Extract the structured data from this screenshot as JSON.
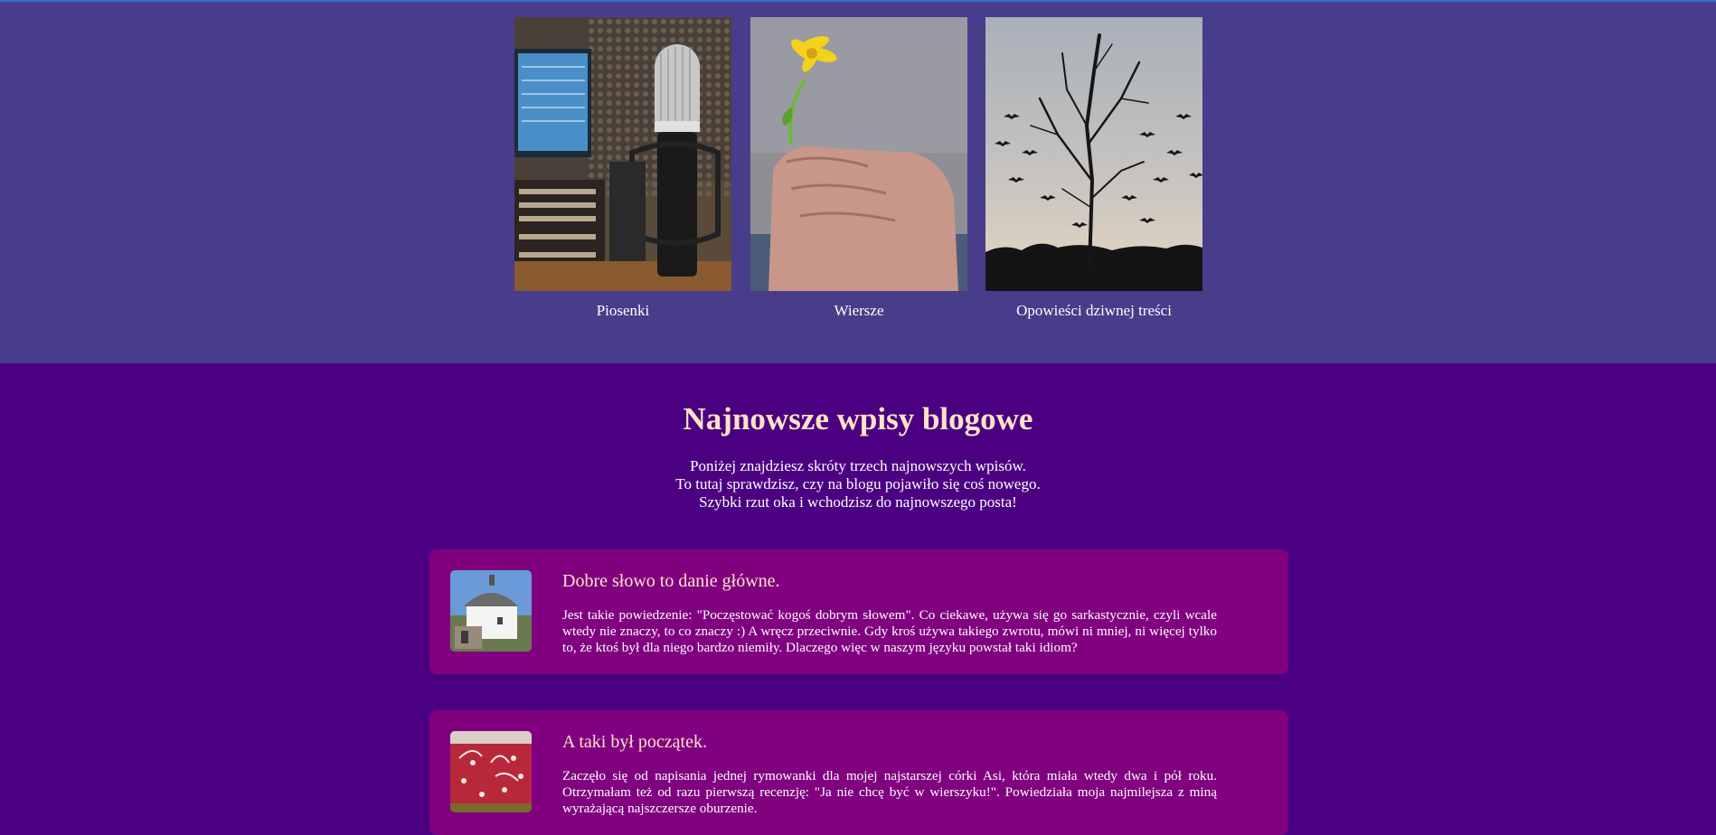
{
  "categories": [
    {
      "label": "Piosenki",
      "icon": "studio-microphone-photo"
    },
    {
      "label": "Wiersze",
      "icon": "hand-holding-flower-photo"
    },
    {
      "label": "Opowieści dziwnej treści",
      "icon": "tree-with-birds-photo"
    }
  ],
  "blog": {
    "title": "Najnowsze wpisy blogowe",
    "intro": [
      "Poniżej znajdziesz skróty trzech najnowszych wpisów.",
      "To tutaj sprawdzisz, czy na blogu pojawiło się coś nowego.",
      "Szybki rzut oka i wchodzisz do najnowszego posta!"
    ]
  },
  "posts": [
    {
      "title": "Dobre słowo to danie główne.",
      "excerpt": "Jest takie powiedzenie: \"Poczęstować kogoś dobrym słowem\". Co ciekawe, używa się go sarkastycznie, czyli wcale wtedy nie znaczy, to co znaczy :) A wręcz przeciwnie. Gdy kroś używa takiego zwrotu, mówi ni mniej, ni więcej tylko to, że ktoś był dla niego bardzo niemiły. Dlaczego więc w naszym języku powstał taki idiom?",
      "icon": "round-house-thumbnail"
    },
    {
      "title": "A taki był początek.",
      "excerpt": "Zaczęło się od napisania jednej rymowanki dla mojej najstarszej córki Asi, która miała wtedy dwa i pół roku. Otrzymałam też od razu pierwszą recenzję: \"Ja nie chcę być w wierszyku!\". Powiedziała moja najmilejsza z miną wyrażającą najszczersze oburzenie.",
      "icon": "red-cake-thumbnail"
    }
  ],
  "colors": {
    "top_band": "#483d8b",
    "page_background": "#4b0082",
    "post_card": "#800080",
    "heading": "#ffe4c4"
  }
}
